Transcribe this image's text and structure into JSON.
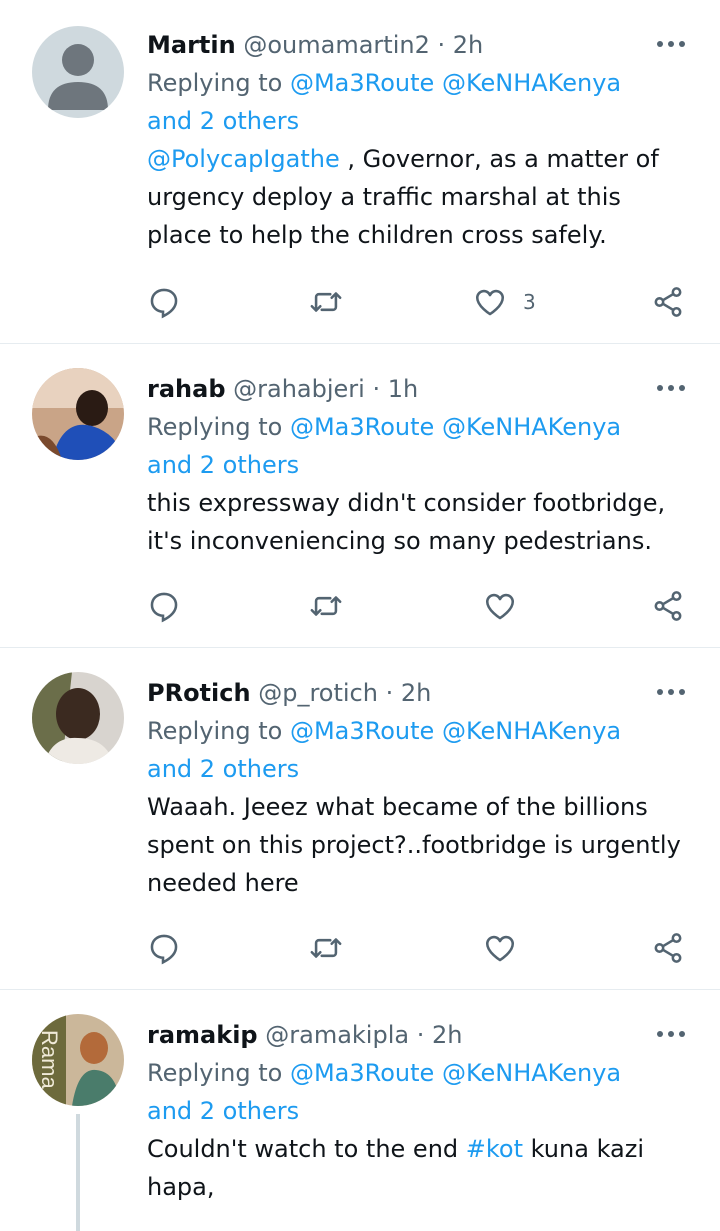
{
  "colors": {
    "link": "#1d9bf0",
    "muted": "#536471",
    "text": "#0f1419",
    "divider": "#e6ecf0"
  },
  "tweets": [
    {
      "name": "Martin",
      "handle": "@oumamartin2",
      "sep": "·",
      "time": "2h",
      "replying_prefix": "Replying to",
      "reply_mention_1": "@Ma3Route",
      "reply_mention_2": "@KeNHAKenya",
      "reply_others": "and 2 others",
      "text_mention": "@PolycapIgathe",
      "text": " , Governor, as a matter of urgency deploy a traffic marshal at this place to help the children cross safely.",
      "like_count": "3",
      "avatar_icon": "default-avatar-icon"
    },
    {
      "name": "rahab",
      "handle": "@rahabjeri",
      "sep": "·",
      "time": "1h",
      "replying_prefix": "Replying to",
      "reply_mention_1": "@Ma3Route",
      "reply_mention_2": "@KeNHAKenya",
      "reply_others": "and 2 others",
      "text": "this expressway  didn't consider footbridge, it's inconveniencing so many pedestrians.",
      "like_count": ""
    },
    {
      "name": "PRotich",
      "handle": "@p_rotich",
      "sep": "·",
      "time": "2h",
      "replying_prefix": "Replying to",
      "reply_mention_1": "@Ma3Route",
      "reply_mention_2": "@KeNHAKenya",
      "reply_others": "and 2 others",
      "text": "Waaah. Jeeez what became of the billions spent on this project?..footbridge is urgently needed here",
      "like_count": ""
    },
    {
      "name": "ramakip",
      "handle": "@ramakipla",
      "sep": "·",
      "time": "2h",
      "replying_prefix": "Replying to",
      "reply_mention_1": "@Ma3Route",
      "reply_mention_2": "@KeNHAKenya",
      "reply_others": "and 2 others",
      "text_before": "Couldn't watch to the end ",
      "hashtag": "#kot",
      "text_after": " kuna kazi hapa,",
      "avatar_text": "Rama"
    }
  ]
}
